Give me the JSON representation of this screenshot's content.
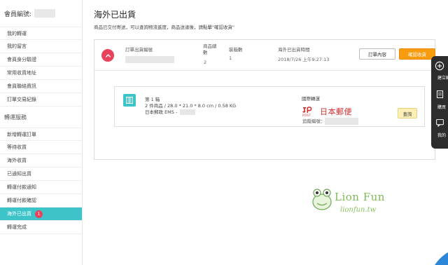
{
  "sidebar": {
    "member_label": "會員編號:",
    "items_top": [
      {
        "label": "我的轉運"
      },
      {
        "label": "我的留言"
      },
      {
        "label": "會員身分驗證"
      },
      {
        "label": "常用收貨地址"
      },
      {
        "label": "會員聯絡資訊"
      },
      {
        "label": "訂單交易紀錄"
      }
    ],
    "group_title": "轉運服務",
    "items_bottom": [
      {
        "label": "新增轉運訂單"
      },
      {
        "label": "等待收貨"
      },
      {
        "label": "海外收貨"
      },
      {
        "label": "已通知出貨"
      },
      {
        "label": "轉運付款通知"
      },
      {
        "label": "轉運付款確認"
      },
      {
        "label": "海外已出貨",
        "badge": "1"
      },
      {
        "label": "轉運完成"
      }
    ]
  },
  "main": {
    "title": "海外已出貨",
    "description": "商品已交付寄送，可以查詢物流進度，商品送達後，請點擊\"確認收貨\""
  },
  "order": {
    "number_label": "訂單出貨編號",
    "product_total_label_1": "商品總",
    "product_total_label_2": "數",
    "product_total_value": "2",
    "box_count_label": "裝箱數",
    "box_count_value": "1",
    "ship_time_label": "海外已出貨時間",
    "ship_time_value": "2018/7/26 上午9:27:13",
    "detail_button": "訂單內容",
    "confirm_button": "確認收貨"
  },
  "shipment": {
    "box_title": "第 1 箱",
    "box_detail": "2 件商品 / 28.0 * 21.0 * 8.0 cm / 0.58 KG",
    "carrier_short": "日本郵政 EMS -",
    "carrier_label": "國際轉運",
    "carrier_logo_text": "日本郵便",
    "carrier_logo_post": "POST",
    "tracking_label": "追蹤編號：",
    "query_button": "查詢"
  },
  "float_toolbar": {
    "items": [
      "建立轉運",
      "購買",
      "我的"
    ]
  },
  "watermark": {
    "text": "Lion Fun",
    "sub": "lionfun.tw"
  },
  "colors": {
    "accent": "#3cc4c9",
    "confirm": "#f79b0f",
    "collapse": "#e9425c",
    "japan_post": "#d42c2c"
  }
}
